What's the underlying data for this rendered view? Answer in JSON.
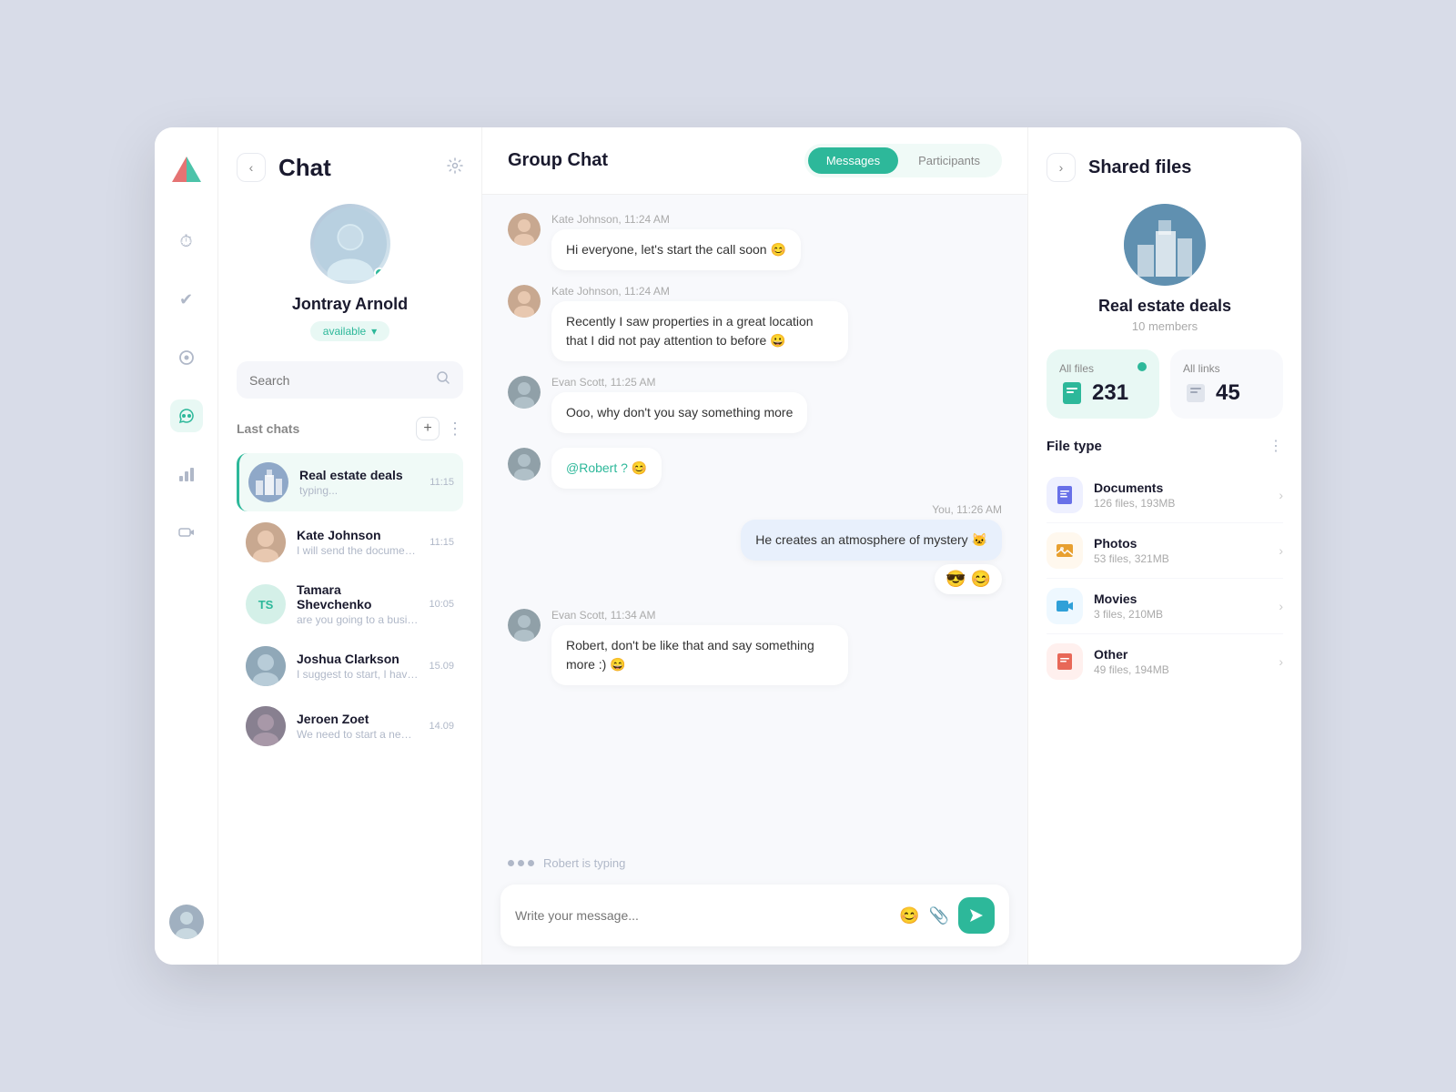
{
  "app": {
    "title": "Chat"
  },
  "nav": {
    "icons": [
      "⏱",
      "✅",
      "👁",
      "👥",
      "📊",
      "🎬"
    ],
    "active_index": 3
  },
  "sidebar": {
    "back_label": "‹",
    "title": "Chat",
    "settings_icon": "⚙",
    "profile": {
      "name": "Jontray Arnold",
      "status": "available",
      "status_arrow": "▾"
    },
    "search_placeholder": "Search",
    "last_chats_label": "Last chats",
    "chats": [
      {
        "name": "Real estate deals",
        "preview": "typing...",
        "time": "11:15",
        "type": "city",
        "active": true
      },
      {
        "name": "Kate Johnson",
        "preview": "I will send the document s...",
        "time": "11:15",
        "type": "person1"
      },
      {
        "name": "Tamara Shevchenko",
        "preview": "are you going to a busine...",
        "time": "10:05",
        "type": "initials",
        "initials": "TS"
      },
      {
        "name": "Joshua Clarkson",
        "preview": "I suggest to start, I have n...",
        "time": "15.09",
        "type": "person3"
      },
      {
        "name": "Jeroen Zoet",
        "preview": "We need to start a new re...",
        "time": "14.09",
        "type": "person4"
      }
    ]
  },
  "chat": {
    "title": "Group Chat",
    "tabs": [
      "Messages",
      "Participants"
    ],
    "active_tab": 0,
    "messages": [
      {
        "id": 1,
        "sender": "Kate Johnson",
        "time": "11:24 AM",
        "text": "Hi everyone, let's start the call soon 😊",
        "self": false,
        "avatar": "kate"
      },
      {
        "id": 2,
        "sender": "Kate Johnson",
        "time": "11:24 AM",
        "text": "Recently I saw properties in a great location that I did not pay attention to before 😀",
        "self": false,
        "avatar": "kate"
      },
      {
        "id": 3,
        "sender": "Evan Scott",
        "time": "11:25 AM",
        "text": "Ooo, why don't you say something more",
        "self": false,
        "avatar": "evan"
      },
      {
        "id": 4,
        "sender": "Evan Scott",
        "time": "11:25 AM",
        "text": "@Robert ? 😊",
        "self": false,
        "avatar": "evan",
        "mention": true
      },
      {
        "id": 5,
        "sender": "You",
        "time": "11:26 AM",
        "text": "He creates an atmosphere of mystery 🐱",
        "self": true,
        "reactions": [
          "😎",
          "😊"
        ]
      },
      {
        "id": 6,
        "sender": "Evan Scott",
        "time": "11:34 AM",
        "text": "Robert, don't be like that and say something more :) 😄",
        "self": false,
        "avatar": "evan"
      }
    ],
    "typing_user": "Robert is typing",
    "input_placeholder": "Write your message..."
  },
  "shared_files": {
    "back_label": "›",
    "title": "Shared files",
    "group": {
      "name": "Real estate deals",
      "members": "10 members"
    },
    "stats": {
      "files_label": "All files",
      "files_count": "231",
      "links_label": "All links",
      "links_count": "45"
    },
    "file_type_label": "File type",
    "file_types": [
      {
        "name": "Documents",
        "meta": "126 files, 193MB",
        "type": "doc"
      },
      {
        "name": "Photos",
        "meta": "53 files, 321MB",
        "type": "photo"
      },
      {
        "name": "Movies",
        "meta": "3 files, 210MB",
        "type": "movie"
      },
      {
        "name": "Other",
        "meta": "49 files, 194MB",
        "type": "other"
      }
    ]
  }
}
